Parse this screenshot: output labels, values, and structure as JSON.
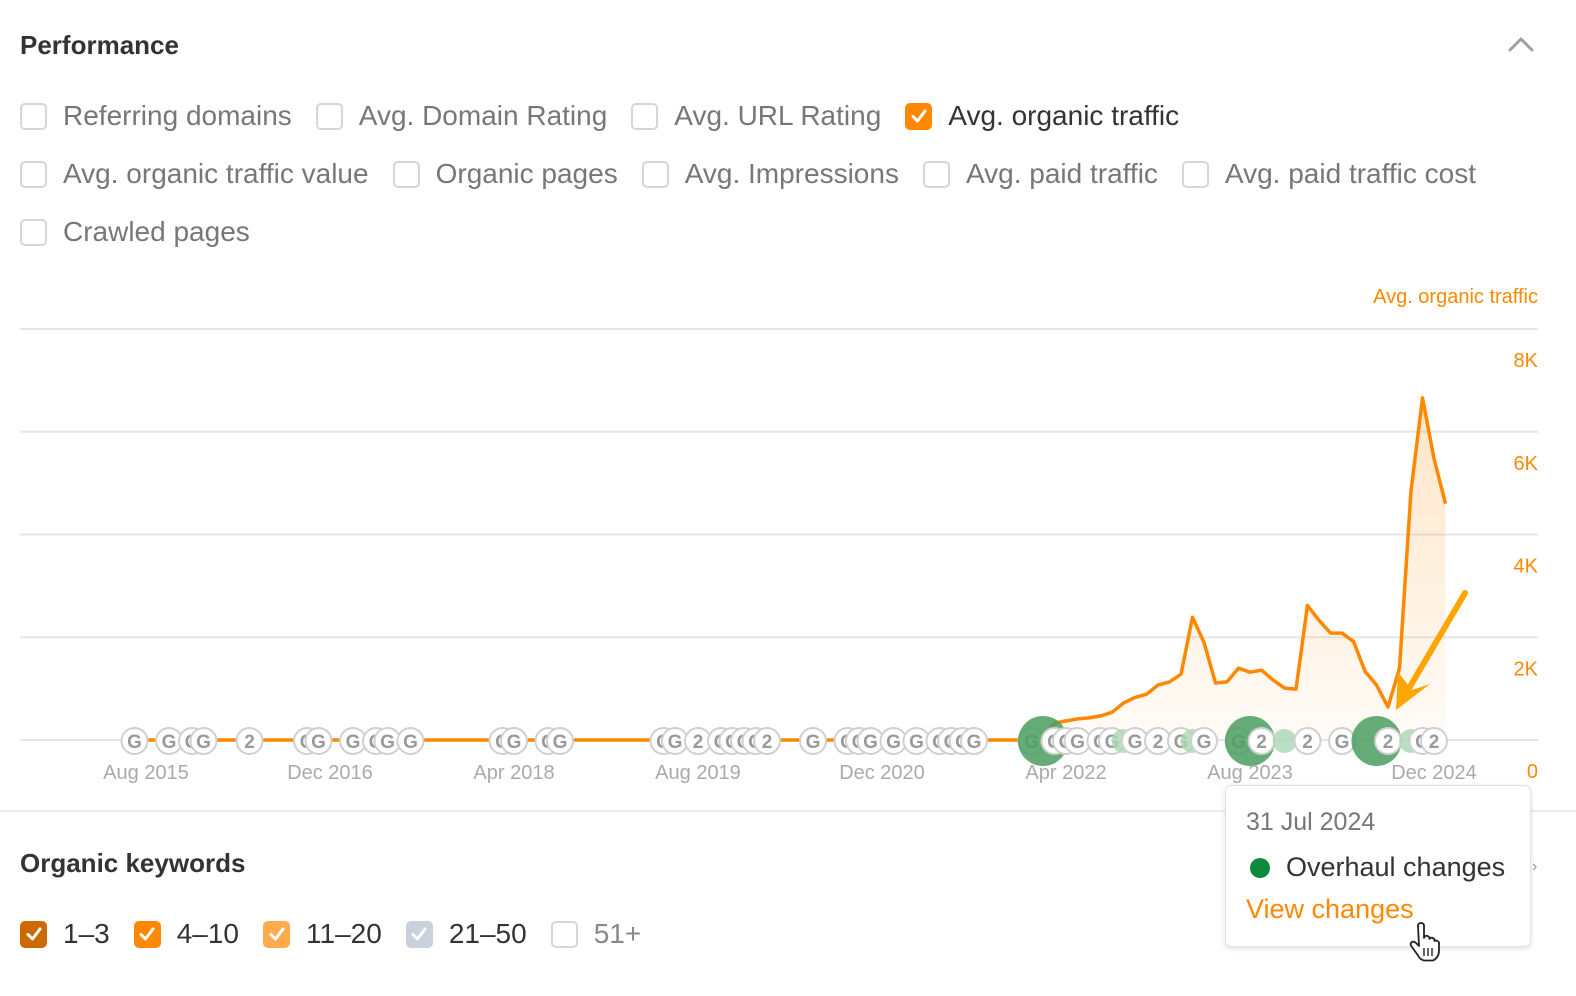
{
  "performance": {
    "title": "Performance",
    "collapse_icon": "chevron-up-icon",
    "metrics": [
      {
        "label": "Referring domains",
        "checked": false
      },
      {
        "label": "Avg. Domain Rating",
        "checked": false
      },
      {
        "label": "Avg. URL Rating",
        "checked": false
      },
      {
        "label": "Avg. organic traffic",
        "checked": true
      },
      {
        "label": "Avg. organic traffic value",
        "checked": false
      },
      {
        "label": "Organic pages",
        "checked": false
      },
      {
        "label": "Avg. Impressions",
        "checked": false
      },
      {
        "label": "Avg. paid traffic",
        "checked": false
      },
      {
        "label": "Avg. paid traffic cost",
        "checked": false
      },
      {
        "label": "Crawled pages",
        "checked": false
      }
    ],
    "accent_color": "#ff8800"
  },
  "chart_data": {
    "type": "area",
    "title": "",
    "series": [
      {
        "name": "Avg. organic traffic",
        "color": "#ff8800",
        "points": [
          [
            "2015-07",
            0
          ],
          [
            "2016-06",
            0
          ],
          [
            "2017-06",
            0
          ],
          [
            "2018-06",
            0
          ],
          [
            "2019-06",
            0
          ],
          [
            "2020-06",
            0
          ],
          [
            "2021-06",
            0
          ],
          [
            "2022-02",
            0
          ],
          [
            "2022-03",
            330
          ],
          [
            "2022-05",
            410
          ],
          [
            "2022-06",
            430
          ],
          [
            "2022-07",
            470
          ],
          [
            "2022-08",
            540
          ],
          [
            "2022-09",
            720
          ],
          [
            "2022-10",
            830
          ],
          [
            "2022-11",
            890
          ],
          [
            "2022-12",
            1070
          ],
          [
            "2023-01",
            1130
          ],
          [
            "2023-02",
            1280
          ],
          [
            "2023-03",
            2390
          ],
          [
            "2023-04",
            1900
          ],
          [
            "2023-05",
            1110
          ],
          [
            "2023-06",
            1130
          ],
          [
            "2023-07",
            1400
          ],
          [
            "2023-08",
            1320
          ],
          [
            "2023-09",
            1360
          ],
          [
            "2023-10",
            1170
          ],
          [
            "2023-11",
            1010
          ],
          [
            "2023-12",
            990
          ],
          [
            "2024-01",
            2620
          ],
          [
            "2024-02",
            2330
          ],
          [
            "2024-03",
            2080
          ],
          [
            "2024-04",
            2080
          ],
          [
            "2024-05",
            1920
          ],
          [
            "2024-06",
            1340
          ],
          [
            "2024-07",
            1070
          ],
          [
            "2024-08",
            640
          ],
          [
            "2024-09",
            1400
          ],
          [
            "2024-10",
            4850
          ],
          [
            "2024-11",
            6660
          ],
          [
            "2024-12",
            5480
          ],
          [
            "2025-01",
            4600
          ]
        ]
      }
    ],
    "xlabel": "",
    "ylabel": "Avg. organic traffic",
    "x_tick_labels": [
      "Aug 2015",
      "Dec 2016",
      "Apr 2018",
      "Aug 2019",
      "Dec 2020",
      "Apr 2022",
      "Aug 2023",
      "Dec 2024"
    ],
    "y_tick_labels": [
      "0",
      "2K",
      "4K",
      "6K",
      "8K"
    ],
    "ylim": [
      0,
      8000
    ],
    "grid": true,
    "y_axis_position": "right",
    "annotations": {
      "markers": [
        {
          "date": "2015-07",
          "label": "G",
          "kind": "google-update"
        },
        {
          "date": "2015-10",
          "label": "G",
          "kind": "google-update"
        },
        {
          "date": "2015-12",
          "label": "G",
          "kind": "google-update"
        },
        {
          "date": "2016-01",
          "label": "G",
          "kind": "google-update"
        },
        {
          "date": "2016-05",
          "label": "2",
          "kind": "cluster"
        },
        {
          "date": "2016-10",
          "label": "G",
          "kind": "google-update"
        },
        {
          "date": "2016-11",
          "label": "G",
          "kind": "google-update"
        },
        {
          "date": "2017-02",
          "label": "G",
          "kind": "google-update"
        },
        {
          "date": "2017-04",
          "label": "G",
          "kind": "google-update"
        },
        {
          "date": "2017-05",
          "label": "G",
          "kind": "google-update"
        },
        {
          "date": "2017-07",
          "label": "G",
          "kind": "google-update"
        },
        {
          "date": "2018-03",
          "label": "G",
          "kind": "google-update"
        },
        {
          "date": "2018-04",
          "label": "G",
          "kind": "google-update"
        },
        {
          "date": "2018-07",
          "label": "G",
          "kind": "google-update"
        },
        {
          "date": "2018-08",
          "label": "G",
          "kind": "google-update"
        },
        {
          "date": "2019-05",
          "label": "G",
          "kind": "google-update"
        },
        {
          "date": "2019-06",
          "label": "G",
          "kind": "google-update"
        },
        {
          "date": "2019-08",
          "label": "2",
          "kind": "cluster"
        },
        {
          "date": "2019-10",
          "label": "G",
          "kind": "google-update"
        },
        {
          "date": "2019-11",
          "label": "G",
          "kind": "google-update"
        },
        {
          "date": "2019-12",
          "label": "G",
          "kind": "google-update"
        },
        {
          "date": "2020-01",
          "label": "G",
          "kind": "google-update"
        },
        {
          "date": "2020-02",
          "label": "2",
          "kind": "cluster"
        },
        {
          "date": "2020-06",
          "label": "G",
          "kind": "google-update"
        },
        {
          "date": "2020-09",
          "label": "G",
          "kind": "google-update"
        },
        {
          "date": "2020-10",
          "label": "G",
          "kind": "google-update"
        },
        {
          "date": "2020-11",
          "label": "G",
          "kind": "google-update"
        },
        {
          "date": "2021-01",
          "label": "G",
          "kind": "google-update"
        },
        {
          "date": "2021-03",
          "label": "G",
          "kind": "google-update"
        },
        {
          "date": "2021-05",
          "label": "G",
          "kind": "google-update"
        },
        {
          "date": "2021-06",
          "label": "G",
          "kind": "google-update"
        },
        {
          "date": "2021-07",
          "label": "G",
          "kind": "google-update"
        },
        {
          "date": "2021-08",
          "label": "G",
          "kind": "google-update"
        },
        {
          "date": "2022-01",
          "label": "G",
          "kind": "google-update"
        },
        {
          "date": "2022-02",
          "label": "",
          "kind": "overhaul-large"
        },
        {
          "date": "2022-03",
          "label": "G",
          "kind": "google-update"
        },
        {
          "date": "2022-04",
          "label": "G",
          "kind": "google-update"
        },
        {
          "date": "2022-05",
          "label": "G",
          "kind": "google-update"
        },
        {
          "date": "2022-07",
          "label": "G",
          "kind": "google-update"
        },
        {
          "date": "2022-08",
          "label": "G",
          "kind": "google-update"
        },
        {
          "date": "2022-09",
          "label": "",
          "kind": "overhaul-small"
        },
        {
          "date": "2022-10",
          "label": "G",
          "kind": "google-update"
        },
        {
          "date": "2022-12",
          "label": "2",
          "kind": "cluster"
        },
        {
          "date": "2023-02",
          "label": "G",
          "kind": "google-update"
        },
        {
          "date": "2023-03",
          "label": "",
          "kind": "overhaul-small"
        },
        {
          "date": "2023-04",
          "label": "G",
          "kind": "google-update"
        },
        {
          "date": "2023-07",
          "label": "G",
          "kind": "google-update"
        },
        {
          "date": "2023-08",
          "label": "",
          "kind": "overhaul-large"
        },
        {
          "date": "2023-09",
          "label": "2",
          "kind": "cluster"
        },
        {
          "date": "2023-11",
          "label": "",
          "kind": "overhaul-small"
        },
        {
          "date": "2024-01",
          "label": "2",
          "kind": "cluster"
        },
        {
          "date": "2024-04",
          "label": "G",
          "kind": "google-update"
        },
        {
          "date": "2024-07",
          "label": "",
          "kind": "overhaul-large"
        },
        {
          "date": "2024-08",
          "label": "2",
          "kind": "cluster"
        },
        {
          "date": "2024-10",
          "label": "",
          "kind": "overhaul-small"
        },
        {
          "date": "2024-11",
          "label": "G",
          "kind": "google-update"
        },
        {
          "date": "2024-12",
          "label": "2",
          "kind": "cluster"
        }
      ],
      "arrow": {
        "points_to": "2024-08",
        "color": "#ffa500"
      }
    }
  },
  "tooltip": {
    "date": "31 Jul 2024",
    "item_label": "Overhaul changes",
    "item_color": "#0d8a3e",
    "link_label": "View changes"
  },
  "organic_keywords": {
    "title": "Organic keywords",
    "ranges": [
      {
        "label": "1–3",
        "checked": true,
        "color": "#cc6a00"
      },
      {
        "label": "4–10",
        "checked": true,
        "color": "#ff8800"
      },
      {
        "label": "11–20",
        "checked": true,
        "color": "#ffaa4d"
      },
      {
        "label": "21–50",
        "checked": true,
        "color": "#c9d1dc"
      },
      {
        "label": "51+",
        "checked": false,
        "color": "#ffffff"
      }
    ]
  }
}
